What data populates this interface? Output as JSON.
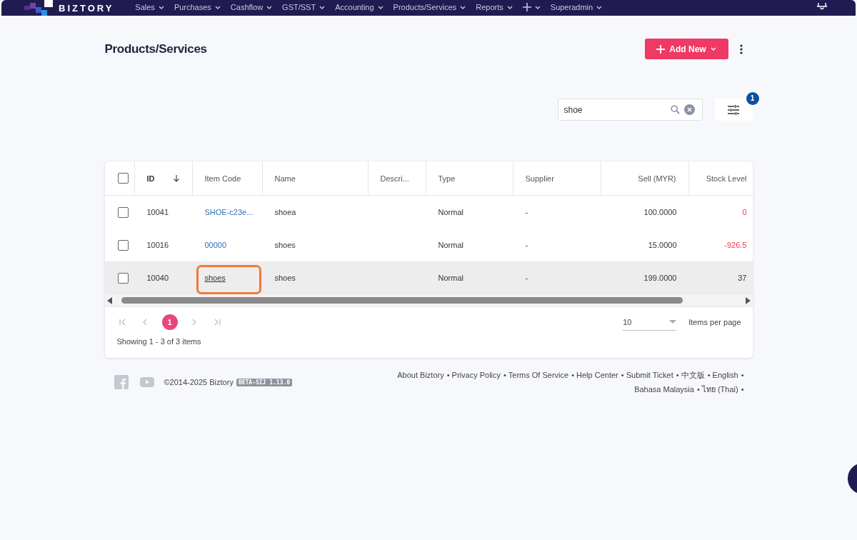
{
  "nav": {
    "brand": "BIZTORY",
    "items": [
      {
        "kind": "text",
        "label": "Sales"
      },
      {
        "kind": "text",
        "label": "Purchases"
      },
      {
        "kind": "text",
        "label": "Cashflow"
      },
      {
        "kind": "text",
        "label": "GST/SST"
      },
      {
        "kind": "text",
        "label": "Accounting"
      },
      {
        "kind": "text",
        "label": "Products/Services"
      },
      {
        "kind": "text",
        "label": "Reports"
      },
      {
        "kind": "plus"
      },
      {
        "kind": "text",
        "label": "Superadmin"
      }
    ]
  },
  "header": {
    "title": "Products/Services",
    "add_button": "Add New"
  },
  "search": {
    "value": "shoe"
  },
  "filter": {
    "badge": "1"
  },
  "table": {
    "columns": [
      {
        "label": "ID",
        "kind": "text",
        "sorted": true
      },
      {
        "label": "Item Code",
        "kind": "text",
        "sorted": false
      },
      {
        "label": "Name",
        "kind": "text",
        "sorted": false
      },
      {
        "label": "Descri...",
        "kind": "text",
        "sorted": false
      },
      {
        "label": "Type",
        "kind": "text",
        "sorted": false
      },
      {
        "label": "Supplier",
        "kind": "text",
        "sorted": false
      },
      {
        "label": "Sell (MYR)",
        "kind": "number",
        "sorted": false
      },
      {
        "label": "Stock Level",
        "kind": "number",
        "sorted": false
      }
    ],
    "all_selected": false,
    "rows": [
      {
        "selected": false,
        "hovered": false,
        "highlighted": false,
        "id": "10041",
        "item_code": "SHOE-c23e...",
        "name": "shoea",
        "type": "Normal",
        "supplier": "-",
        "sell": "100.0000",
        "stock": "0",
        "low_stock": true
      },
      {
        "selected": false,
        "hovered": false,
        "highlighted": false,
        "id": "10016",
        "item_code": "00000",
        "name": "shoes",
        "type": "Normal",
        "supplier": "-",
        "sell": "15.0000",
        "stock": "-926.5",
        "low_stock": true
      },
      {
        "selected": false,
        "hovered": true,
        "highlighted": true,
        "id": "10040",
        "item_code": "shoes",
        "name": "shoes",
        "type": "Normal",
        "supplier": "-",
        "sell": "199.0000",
        "stock": "37",
        "low_stock": false
      }
    ]
  },
  "pager": {
    "pages": [
      {
        "label": "1",
        "selected": true
      }
    ],
    "per_page": "10",
    "per_page_label": "Items per page",
    "summary": "Showing 1 - 3 of 3 items"
  },
  "footer": {
    "copyright": "©2014-2025 Biztory",
    "version": "BETA-SIJ 1.13.0",
    "separator": "•",
    "links": [
      "About Biztory",
      "Privacy Policy",
      "Terms Of Service",
      "Help Center",
      "Submit Ticket",
      "中文版",
      "English",
      "Bahasa Malaysia",
      "ไทย (Thai)"
    ]
  }
}
